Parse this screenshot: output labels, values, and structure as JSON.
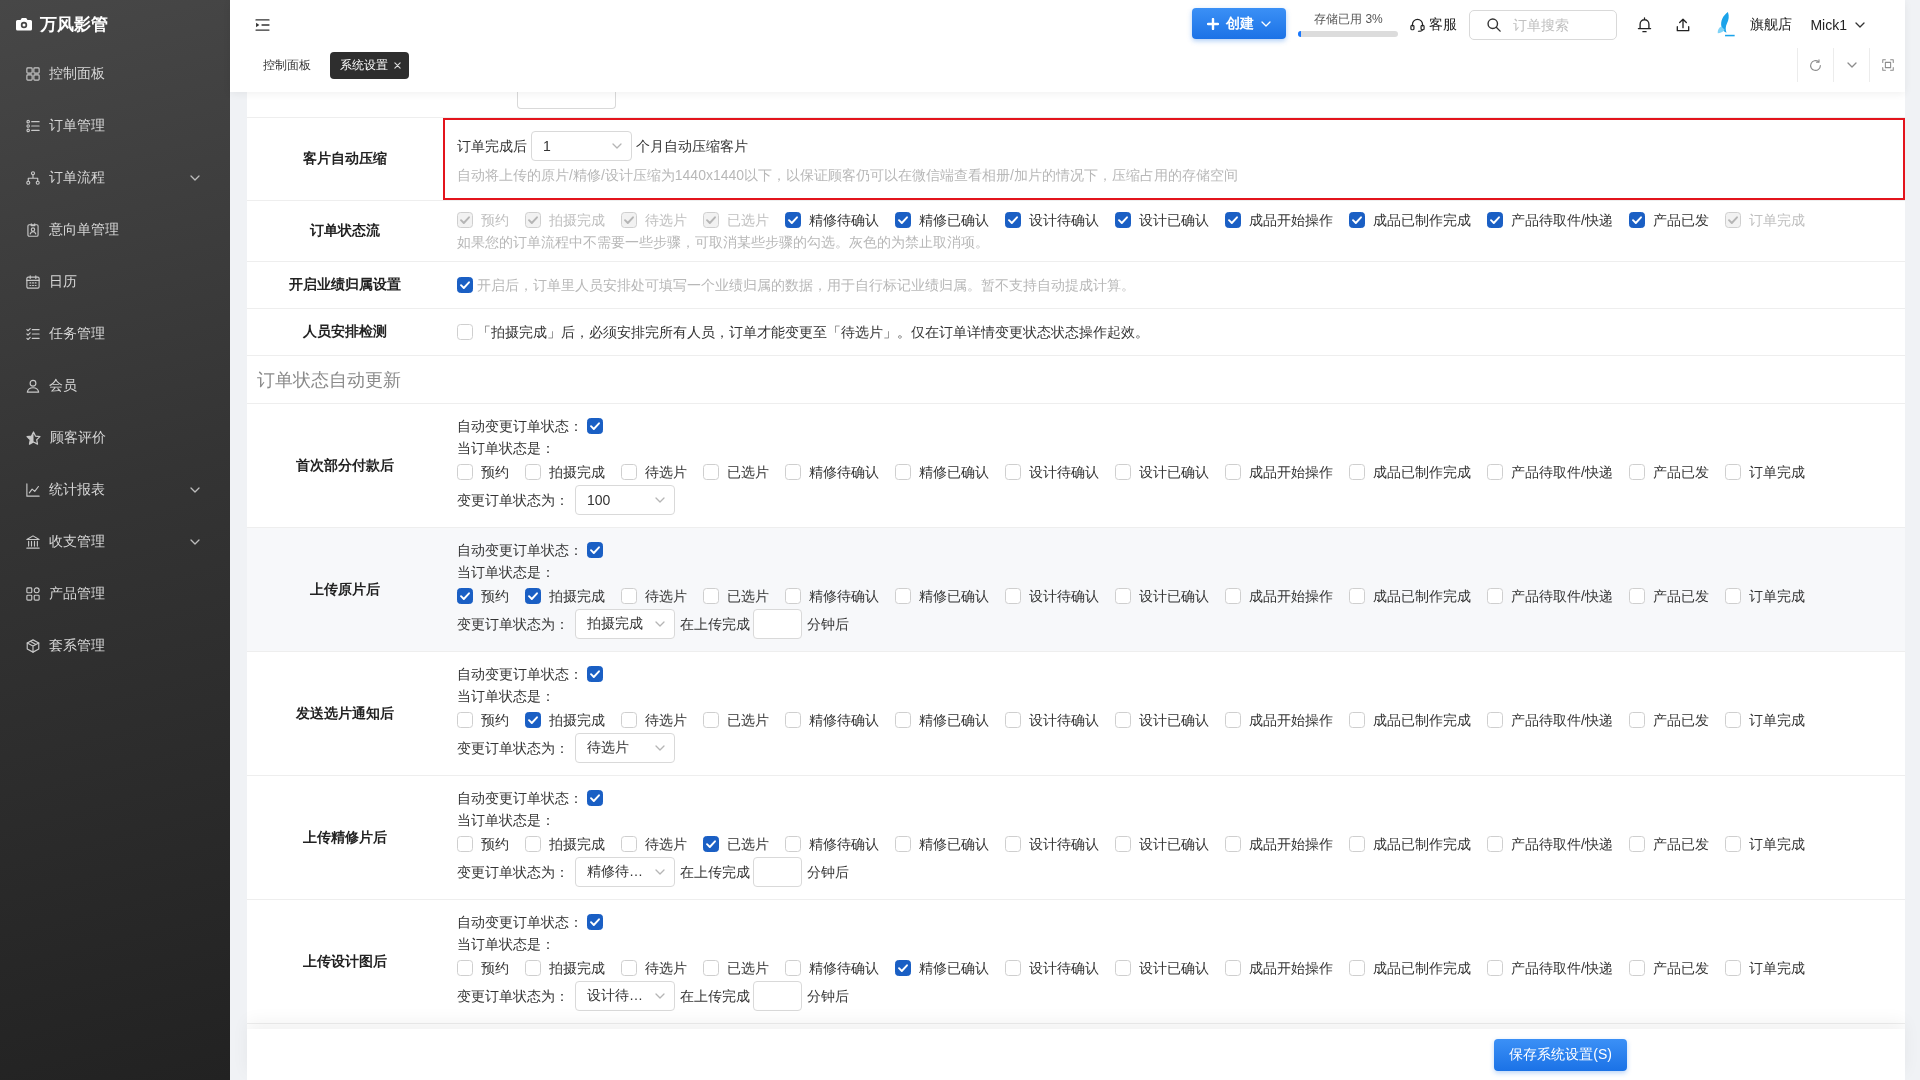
{
  "sidebar": {
    "brand": "万风影管",
    "items": [
      {
        "label": "控制面板",
        "submenu": false
      },
      {
        "label": "订单管理",
        "submenu": false
      },
      {
        "label": "订单流程",
        "submenu": true
      },
      {
        "label": "意向单管理",
        "submenu": false
      },
      {
        "label": "日历",
        "submenu": false
      },
      {
        "label": "任务管理",
        "submenu": false
      },
      {
        "label": "会员",
        "submenu": false
      },
      {
        "label": "顾客评价",
        "submenu": false
      },
      {
        "label": "统计报表",
        "submenu": true
      },
      {
        "label": "收支管理",
        "submenu": true
      },
      {
        "label": "产品管理",
        "submenu": false
      },
      {
        "label": "套系管理",
        "submenu": false
      }
    ]
  },
  "header": {
    "create_button": "创建",
    "storage": {
      "label": "存储已用 3%",
      "level": 0.03
    },
    "support": "客服",
    "search": {
      "placeholder": "订单搜索"
    },
    "store": "旗舰店",
    "user": "Mick1"
  },
  "tabs": [
    {
      "label": "控制面板",
      "selected": false,
      "closable": false
    },
    {
      "label": "系统设置",
      "selected": true,
      "closable": true
    }
  ],
  "settings": [
    {
      "label": "客片自动压缩",
      "kind": "compress",
      "outlined": true,
      "prefix": "订单完成后",
      "select": "1",
      "suffix": "个月自动压缩客片",
      "hint": "自动将上传的原片/精修/设计压缩为1440x1440以下，以保证顾客仍可以在微信端查看相册/加片的情况下，压缩占用的存储空间"
    },
    {
      "label": "订单状态流",
      "kind": "status_flow",
      "outlined": false,
      "options": [
        {
          "label": "预约",
          "checked": true,
          "disabled": true
        },
        {
          "label": "拍摄完成",
          "checked": true,
          "disabled": true
        },
        {
          "label": "待选片",
          "checked": true,
          "disabled": true
        },
        {
          "label": "已选片",
          "checked": true,
          "disabled": true
        },
        {
          "label": "精修待确认",
          "checked": true,
          "disabled": false
        },
        {
          "label": "精修已确认",
          "checked": true,
          "disabled": false
        },
        {
          "label": "设计待确认",
          "checked": true,
          "disabled": false
        },
        {
          "label": "设计已确认",
          "checked": true,
          "disabled": false
        },
        {
          "label": "成品开始操作",
          "checked": true,
          "disabled": false
        },
        {
          "label": "成品已制作完成",
          "checked": true,
          "disabled": false
        },
        {
          "label": "产品待取件/快递",
          "checked": true,
          "disabled": false
        },
        {
          "label": "产品已发",
          "checked": true,
          "disabled": false
        },
        {
          "label": "订单完成",
          "checked": true,
          "disabled": true
        }
      ],
      "hint": "如果您的订单流程中不需要一些步骤，可取消某些步骤的勾选。灰色的为禁止取消项。"
    },
    {
      "label": "开启业绩归属设置",
      "kind": "checkbox",
      "outlined": false,
      "checked": true,
      "hint": "开启后，订单里人员安排处可填写一个业绩归属的数据，用于自行标记业绩归属。暂不支持自动提成计算。"
    },
    {
      "label": "人员安排检测",
      "kind": "checkbox",
      "outlined": false,
      "checked": false,
      "text": "「拍摄完成」后，必须安排完所有人员，订单才能变更至「待选片」。仅在订单详情变更状态状态操作起效。"
    }
  ],
  "auto_update": {
    "title": "订单状态自动更新",
    "rules": [
      {
        "label": "首次部分付款后",
        "hovered": false,
        "auto_label": "自动变更订单状态：",
        "auto": true,
        "when_label": "当订单状态是：",
        "statuses": [
          {
            "label": "预约",
            "checked": false
          },
          {
            "label": "拍摄完成",
            "checked": false
          },
          {
            "label": "待选片",
            "checked": false
          },
          {
            "label": "已选片",
            "checked": false
          },
          {
            "label": "精修待确认",
            "checked": false
          },
          {
            "label": "精修已确认",
            "checked": false
          },
          {
            "label": "设计待确认",
            "checked": false
          },
          {
            "label": "设计已确认",
            "checked": false
          },
          {
            "label": "成品开始操作",
            "checked": false
          },
          {
            "label": "成品已制作完成",
            "checked": false
          },
          {
            "label": "产品待取件/快递",
            "checked": false
          },
          {
            "label": "产品已发",
            "checked": false
          },
          {
            "label": "订单完成",
            "checked": false
          }
        ],
        "target_label": "变更订单状态为：",
        "target": "100"
      },
      {
        "label": "上传原片后",
        "hovered": true,
        "auto_label": "自动变更订单状态：",
        "auto": true,
        "when_label": "当订单状态是：",
        "statuses": [
          {
            "label": "预约",
            "checked": true
          },
          {
            "label": "拍摄完成",
            "checked": true
          },
          {
            "label": "待选片",
            "checked": false
          },
          {
            "label": "已选片",
            "checked": false
          },
          {
            "label": "精修待确认",
            "checked": false
          },
          {
            "label": "精修已确认",
            "checked": false
          },
          {
            "label": "设计待确认",
            "checked": false
          },
          {
            "label": "设计已确认",
            "checked": false
          },
          {
            "label": "成品开始操作",
            "checked": false
          },
          {
            "label": "成品已制作完成",
            "checked": false
          },
          {
            "label": "产品待取件/快递",
            "checked": false
          },
          {
            "label": "产品已发",
            "checked": false
          },
          {
            "label": "订单完成",
            "checked": false
          }
        ],
        "target_label": "变更订单状态为：",
        "target": "拍摄完成",
        "delay_prefix": "在上传完成",
        "delay_suffix": "分钟后"
      },
      {
        "label": "发送选片通知后",
        "hovered": false,
        "auto_label": "自动变更订单状态：",
        "auto": true,
        "when_label": "当订单状态是：",
        "statuses": [
          {
            "label": "预约",
            "checked": false
          },
          {
            "label": "拍摄完成",
            "checked": true
          },
          {
            "label": "待选片",
            "checked": false
          },
          {
            "label": "已选片",
            "checked": false
          },
          {
            "label": "精修待确认",
            "checked": false
          },
          {
            "label": "精修已确认",
            "checked": false
          },
          {
            "label": "设计待确认",
            "checked": false
          },
          {
            "label": "设计已确认",
            "checked": false
          },
          {
            "label": "成品开始操作",
            "checked": false
          },
          {
            "label": "成品已制作完成",
            "checked": false
          },
          {
            "label": "产品待取件/快递",
            "checked": false
          },
          {
            "label": "产品已发",
            "checked": false
          },
          {
            "label": "订单完成",
            "checked": false
          }
        ],
        "target_label": "变更订单状态为：",
        "target": "待选片"
      },
      {
        "label": "上传精修片后",
        "hovered": false,
        "auto_label": "自动变更订单状态：",
        "auto": true,
        "when_label": "当订单状态是：",
        "statuses": [
          {
            "label": "预约",
            "checked": false
          },
          {
            "label": "拍摄完成",
            "checked": false
          },
          {
            "label": "待选片",
            "checked": false
          },
          {
            "label": "已选片",
            "checked": true
          },
          {
            "label": "精修待确认",
            "checked": false
          },
          {
            "label": "精修已确认",
            "checked": false
          },
          {
            "label": "设计待确认",
            "checked": false
          },
          {
            "label": "设计已确认",
            "checked": false
          },
          {
            "label": "成品开始操作",
            "checked": false
          },
          {
            "label": "成品已制作完成",
            "checked": false
          },
          {
            "label": "产品待取件/快递",
            "checked": false
          },
          {
            "label": "产品已发",
            "checked": false
          },
          {
            "label": "订单完成",
            "checked": false
          }
        ],
        "target_label": "变更订单状态为：",
        "target": "精修待…",
        "delay_prefix": "在上传完成",
        "delay_suffix": "分钟后"
      },
      {
        "label": "上传设计图后",
        "hovered": false,
        "auto_label": "自动变更订单状态：",
        "auto": true,
        "when_label": "当订单状态是：",
        "statuses": [
          {
            "label": "预约",
            "checked": false
          },
          {
            "label": "拍摄完成",
            "checked": false
          },
          {
            "label": "待选片",
            "checked": false
          },
          {
            "label": "已选片",
            "checked": false
          },
          {
            "label": "精修待确认",
            "checked": false
          },
          {
            "label": "精修已确认",
            "checked": true
          },
          {
            "label": "设计待确认",
            "checked": false
          },
          {
            "label": "设计已确认",
            "checked": false
          },
          {
            "label": "成品开始操作",
            "checked": false
          },
          {
            "label": "成品已制作完成",
            "checked": false
          },
          {
            "label": "产品待取件/快递",
            "checked": false
          },
          {
            "label": "产品已发",
            "checked": false
          },
          {
            "label": "订单完成",
            "checked": false
          }
        ],
        "target_label": "变更订单状态为：",
        "target": "设计待…",
        "delay_prefix": "在上传完成",
        "delay_suffix": "分钟后"
      }
    ]
  },
  "save_button": "保存系统设置(S)"
}
